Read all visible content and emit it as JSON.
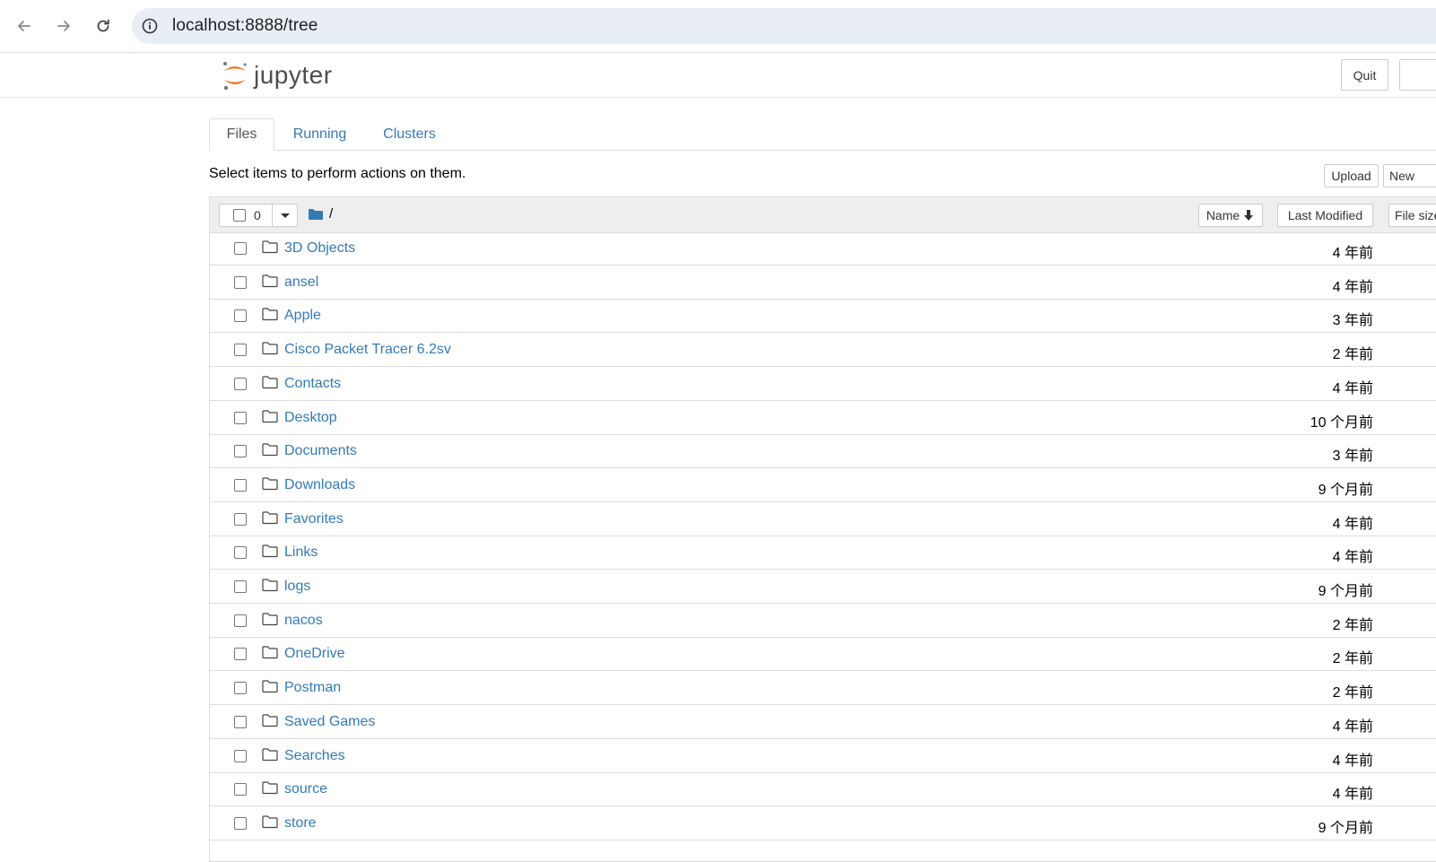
{
  "browser": {
    "url": "localhost:8888/tree",
    "back_icon": "arrow-left-icon",
    "forward_icon": "arrow-right-icon",
    "reload_icon": "reload-icon",
    "info_icon": "info-icon"
  },
  "header": {
    "logo_text": "jupyter",
    "quit_label": "Quit"
  },
  "tabs": [
    {
      "label": "Files",
      "active": true
    },
    {
      "label": "Running",
      "active": false
    },
    {
      "label": "Clusters",
      "active": false
    }
  ],
  "toolbar": {
    "instructions": "Select items to perform actions on them.",
    "upload_label": "Upload",
    "new_label": "New"
  },
  "list_header": {
    "selected_count": "0",
    "breadcrumb": "/",
    "sort_name_label": "Name",
    "sort_modified_label": "Last Modified",
    "sort_size_label": "File size"
  },
  "items": [
    {
      "name": "3D Objects",
      "modified": "4 年前"
    },
    {
      "name": "ansel",
      "modified": "4 年前"
    },
    {
      "name": "Apple",
      "modified": "3 年前"
    },
    {
      "name": "Cisco Packet Tracer 6.2sv",
      "modified": "2 年前"
    },
    {
      "name": "Contacts",
      "modified": "4 年前"
    },
    {
      "name": "Desktop",
      "modified": "10 个月前"
    },
    {
      "name": "Documents",
      "modified": "3 年前"
    },
    {
      "name": "Downloads",
      "modified": "9 个月前"
    },
    {
      "name": "Favorites",
      "modified": "4 年前"
    },
    {
      "name": "Links",
      "modified": "4 年前"
    },
    {
      "name": "logs",
      "modified": "9 个月前"
    },
    {
      "name": "nacos",
      "modified": "2 年前"
    },
    {
      "name": "OneDrive",
      "modified": "2 年前"
    },
    {
      "name": "Postman",
      "modified": "2 年前"
    },
    {
      "name": "Saved Games",
      "modified": "4 年前"
    },
    {
      "name": "Searches",
      "modified": "4 年前"
    },
    {
      "name": "source",
      "modified": "4 年前"
    },
    {
      "name": "store",
      "modified": "9 个月前"
    }
  ],
  "colors": {
    "link": "#337ab7",
    "logo_orange": "#f37626",
    "header_bg": "#eeeeee",
    "omnibox_bg": "#e9edf4"
  }
}
